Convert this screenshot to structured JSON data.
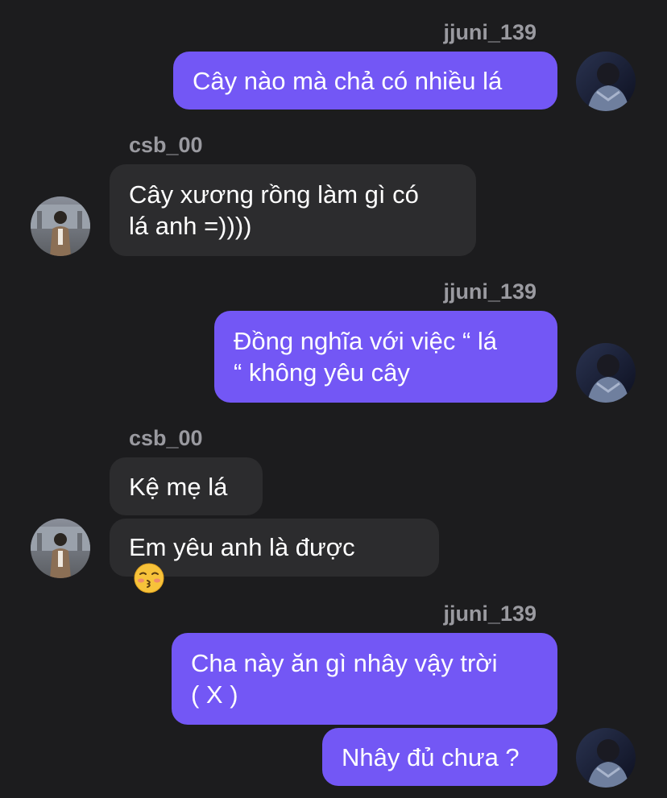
{
  "thread": {
    "users": {
      "me": "jjuni_139",
      "other": "csb_00"
    },
    "messages": [
      {
        "from": "jjuni_139",
        "text": "Cây nào mà chả có nhiều lá"
      },
      {
        "from": "csb_00",
        "text": "Cây xương rồng làm gì có\nlá anh =))))"
      },
      {
        "from": "jjuni_139",
        "text": "Đồng nghĩa với việc “ lá\n“ không yêu cây"
      },
      {
        "from": "csb_00",
        "text": "Kệ mẹ lá"
      },
      {
        "from": "csb_00",
        "text": "Em yêu anh là được",
        "emoji": "kissing-face-with-closed-eyes"
      },
      {
        "from": "jjuni_139",
        "text": "Cha này ăn gì nhây vậy trời\n( X )"
      },
      {
        "from": "jjuni_139",
        "text": "Nhây đủ chưa ?"
      }
    ]
  },
  "colors": {
    "background": "#1c1c1e",
    "outgoing_bubble": "#7357f5",
    "incoming_bubble": "#2c2c2e",
    "username": "#9a9aa0"
  }
}
